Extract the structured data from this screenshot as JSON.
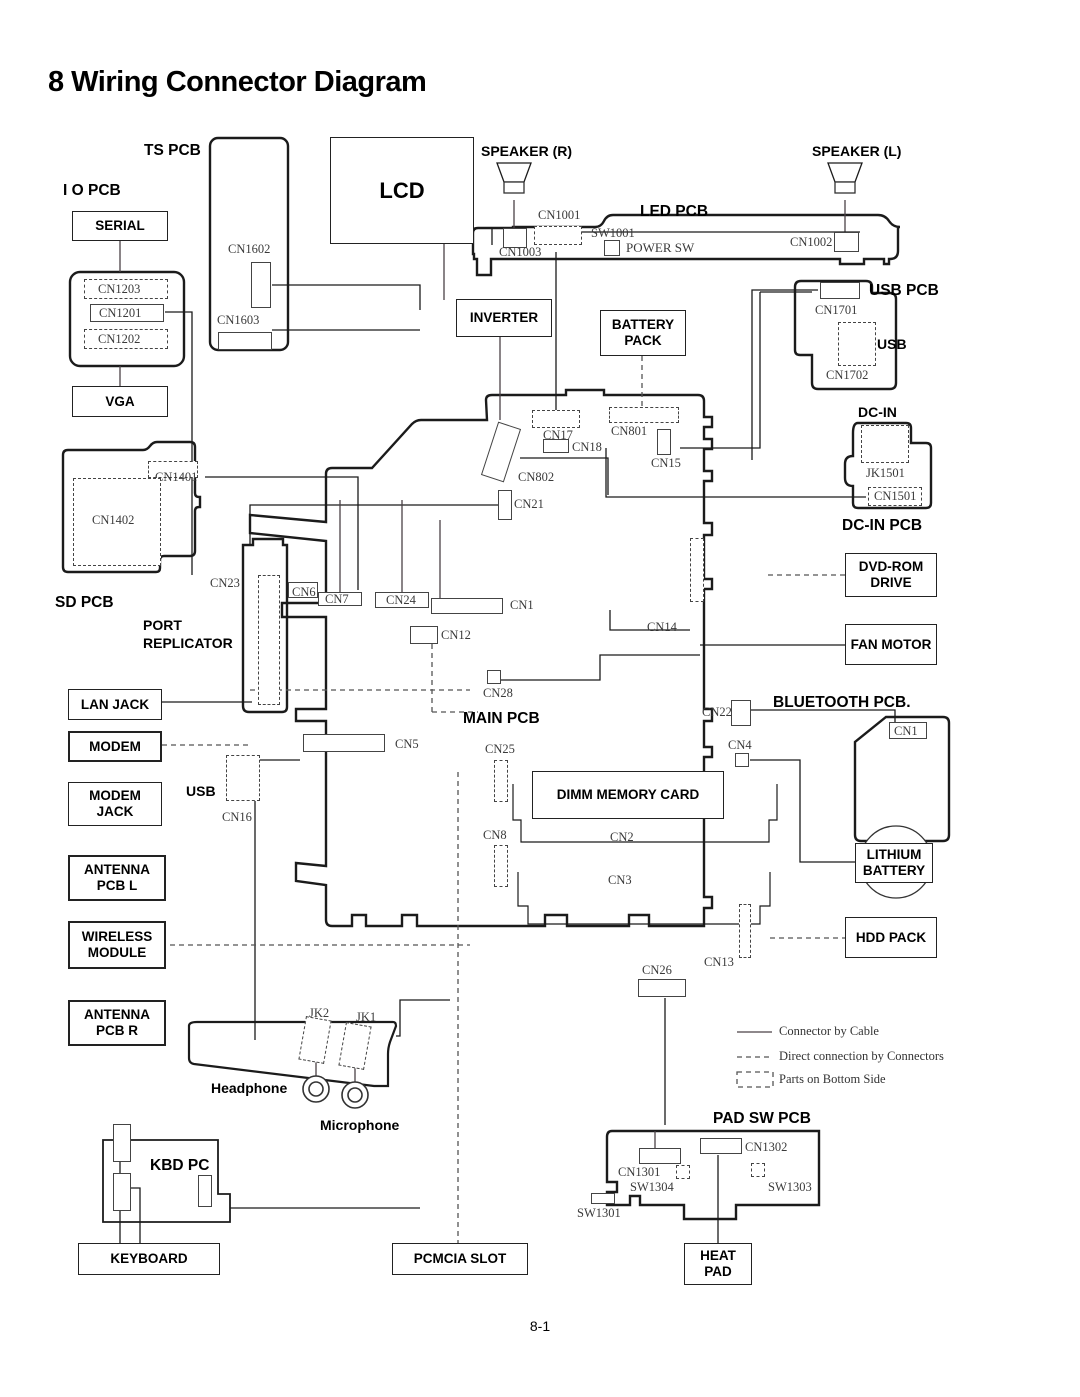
{
  "document": {
    "title": "8 Wiring Connector Diagram",
    "page_number": "8-1"
  },
  "headings": {
    "lcd_ts_pcb": "TS PCB",
    "io_pcb": "I O PCB",
    "led_pcb": "LED PCB",
    "usb_pcb": "USB PCB",
    "dc_in_pcb": "DC-IN PCB",
    "sd_pcb": "SD PCB",
    "main_pcb": "MAIN PCB",
    "bluetooth_pcb": "BLUETOOTH PCB.",
    "pad_sw_pcb": "PAD SW PCB",
    "kbd_pcb": "KBD PC",
    "port_replicator": "PORT\nREPLICATOR",
    "speaker_r": "SPEAKER (R)",
    "speaker_l": "SPEAKER (L)",
    "dc_in": "DC-IN",
    "usb_label": "USB",
    "usb_label2": "USB",
    "headphone": "Headphone",
    "microphone": "Microphone"
  },
  "blocks": {
    "serial": "SERIAL",
    "vga": "VGA",
    "lcd": "LCD",
    "inverter": "INVERTER",
    "battery_pack": "BATTERY\nPACK",
    "power_sw": "POWER SW",
    "dvd_rom_drive": "DVD-ROM\nDRIVE",
    "fan_motor": "FAN MOTOR",
    "lan_jack": "LAN JACK",
    "modem": "MODEM",
    "modem_jack": "MODEM\nJACK",
    "antenna_pcb_l": "ANTENNA\nPCB L",
    "wireless_module": "WIRELESS\nMODULE",
    "antenna_pcb_r": "ANTENNA\nPCB R",
    "dimm_memory_card": "DIMM MEMORY CARD",
    "lithium_battery": "LITHIUM\nBATTERY",
    "hdd_pack": "HDD PACK",
    "keyboard": "KEYBOARD",
    "pcmcia_slot": "PCMCIA SLOT",
    "heat_pad": "HEAT\nPAD"
  },
  "connectors": {
    "cn1203": "CN1203",
    "cn1201": "CN1201",
    "cn1202": "CN1202",
    "cn1602": "CN1602",
    "cn1603": "CN1603",
    "cn1001": "CN1001",
    "cn1003": "CN1003",
    "cn1002": "CN1002",
    "sw1001": "SW1001",
    "cn1701": "CN1701",
    "cn1702": "CN1702",
    "cn801": "CN801",
    "cn17": "CN17",
    "cn18": "CN18",
    "cn15": "CN15",
    "cn802": "CN802",
    "cn21": "CN21",
    "jk1501": "JK1501",
    "cn1501": "CN1501",
    "cn1401": "CN1401",
    "cn1402": "CN1402",
    "cn23": "CN23",
    "cn6": "CN6",
    "cn7": "CN7",
    "cn24": "CN24",
    "cn1": "CN1",
    "cn12": "CN12",
    "cn14": "CN14",
    "cn28": "CN28",
    "cn5": "CN5",
    "cn16": "CN16",
    "cn25": "CN25",
    "cn8": "CN8",
    "cn2": "CN2",
    "cn3": "CN3",
    "cn22": "CN22",
    "cn4": "CN4",
    "cn13": "CN13",
    "cn26": "CN26",
    "cn1_bt": "CN1",
    "jk2": "JK2",
    "jk1": "JK1",
    "cn1301": "CN1301",
    "cn1302": "CN1302",
    "sw1304": "SW1304",
    "sw1303": "SW1303",
    "sw1301": "SW1301"
  },
  "legend": {
    "cable": "Connector by Cable",
    "direct": "Direct connection by Connectors",
    "bottom": "Parts on Bottom Side"
  },
  "colors": {
    "ink": "#1b1b1b",
    "wire": "#4a4146",
    "label": "#3a3a3a",
    "paper": "#ffffff"
  }
}
